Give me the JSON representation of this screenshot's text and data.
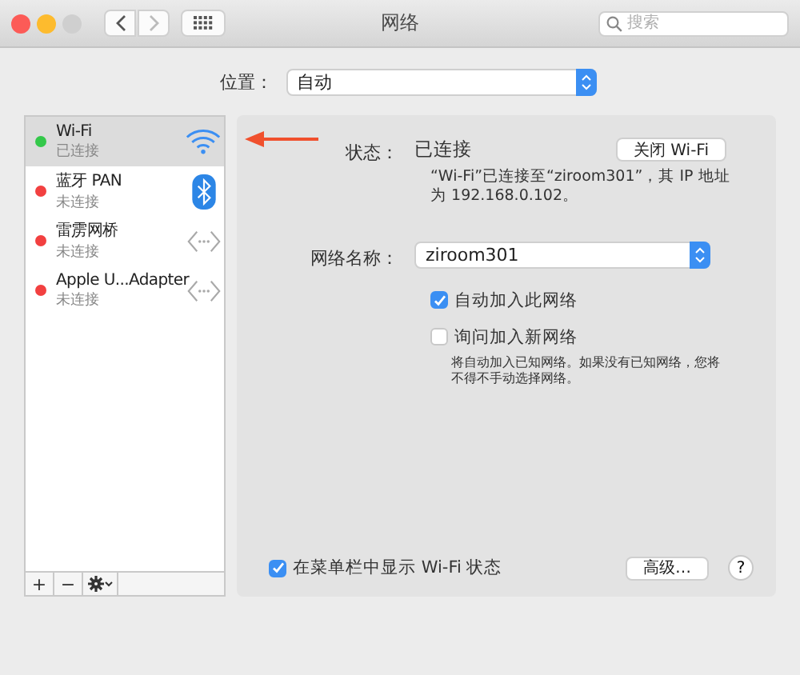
{
  "window": {
    "title": "网络",
    "search": {
      "placeholder": "搜索"
    }
  },
  "location": {
    "label": "位置：",
    "value": "自动"
  },
  "services": [
    {
      "name": "Wi-Fi",
      "status": "已连接",
      "connected": true,
      "selected": true,
      "kind": "wifi"
    },
    {
      "name": "蓝牙 PAN",
      "status": "未连接",
      "connected": false,
      "selected": false,
      "kind": "bluetooth"
    },
    {
      "name": "雷雳网桥",
      "status": "未连接",
      "connected": false,
      "selected": false,
      "kind": "bridge"
    },
    {
      "name": "Apple U...Adapter",
      "status": "未连接",
      "connected": false,
      "selected": false,
      "kind": "bridge"
    }
  ],
  "list_toolbar": [
    "+",
    "−"
  ],
  "detail": {
    "status_label": "状态：",
    "status_value": "已连接",
    "toggle_button": "关闭 Wi-Fi",
    "status_description": "“Wi-Fi”已连接至“ziroom301”，其 IP 地址为 192.168.0.102。",
    "network_label": "网络名称：",
    "network_value": "ziroom301",
    "options": [
      {
        "label": "自动加入此网络",
        "checked": true
      },
      {
        "label": "询问加入新网络",
        "checked": false
      }
    ],
    "hint": "将自动加入已知网络。如果没有已知网络，您将不得不手动选择网络。",
    "menubar_option": {
      "label": "在菜单栏中显示 Wi-Fi 状态",
      "checked": true
    },
    "advanced_button": "高级…",
    "help_button": "?"
  }
}
